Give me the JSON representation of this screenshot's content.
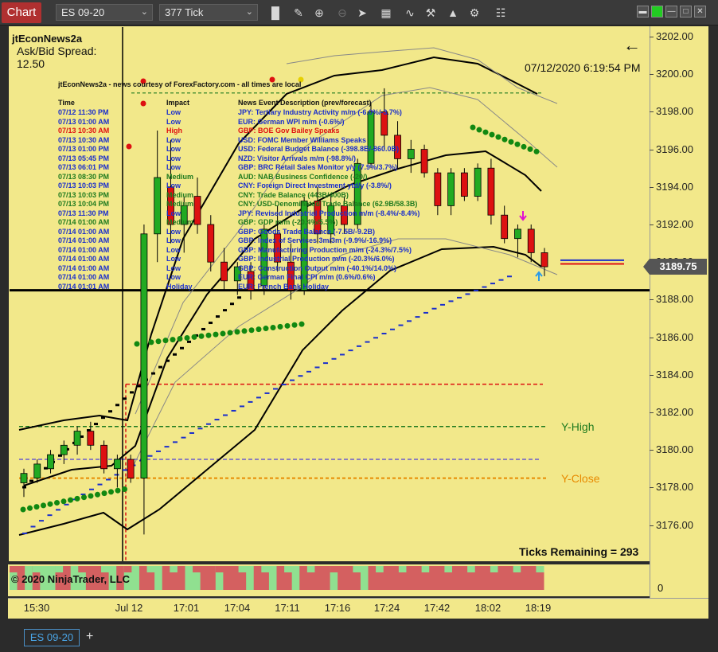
{
  "toolbar": {
    "chart_tab": "Chart",
    "instrument": "ES 09-20",
    "interval": "377 Tick",
    "icons": [
      "bar-type-icon",
      "drawing-tool-icon",
      "zoom-in-icon",
      "zoom-out-icon",
      "pointer-icon",
      "data-box-icon",
      "indicators-icon",
      "strategies-icon",
      "properties-icon"
    ],
    "window_buttons": [
      "minimize-icon",
      "link-icon",
      "restore-icon",
      "close-icon"
    ]
  },
  "chart": {
    "indicator_name": "jtEconNews2a",
    "spread_label": "Ask/Bid Spread:",
    "spread_value": "12.50",
    "timestamp": "07/12/2020 6:19:54 PM",
    "news_caption": "jtEconNews2a - news courtesy of ForexFactory.com - all times are local",
    "news_columns": [
      "Time",
      "Impact",
      "News Event Description (prev/forecast)"
    ],
    "news": [
      {
        "time": "07/12 11:30 PM",
        "impact": "Low",
        "desc": "JPY: Tertiary Industry Activity m/m (-6.0%/-3.7%)",
        "color": "#1a2ecc"
      },
      {
        "time": "07/13 01:00 AM",
        "impact": "Low",
        "desc": "EUR: German WPI m/m (-0.6%/)",
        "color": "#1a2ecc"
      },
      {
        "time": "07/13 10:30 AM",
        "impact": "High",
        "desc": "GBP: BOE Gov Bailey Speaks",
        "color": "#e01010"
      },
      {
        "time": "07/13 10:30 AM",
        "impact": "Low",
        "desc": "USD: FOMC Member Williams Speaks",
        "color": "#1a2ecc"
      },
      {
        "time": "07/13 01:00 PM",
        "impact": "Low",
        "desc": "USD: Federal Budget Balance (-398.8B/-860.0B)",
        "color": "#1a2ecc"
      },
      {
        "time": "07/13 05:45 PM",
        "impact": "Low",
        "desc": "NZD: Visitor Arrivals m/m (-98.8%/)",
        "color": "#1a2ecc"
      },
      {
        "time": "07/13 06:01 PM",
        "impact": "Low",
        "desc": "GBP: BRC Retail Sales Monitor y/y (7.9%/3.7%)",
        "color": "#1a2ecc"
      },
      {
        "time": "07/13 08:30 PM",
        "impact": "Medium",
        "desc": "AUD: NAB Business Confidence (-20/)",
        "color": "#1e7a1e"
      },
      {
        "time": "07/13 10:03 PM",
        "impact": "Low",
        "desc": "CNY: Foreign Direct Investment ytd/y (-3.8%/)",
        "color": "#1a2ecc"
      },
      {
        "time": "07/13 10:03 PM",
        "impact": "Medium",
        "desc": "CNY: Trade Balance (443B/400B)",
        "color": "#1e7a1e"
      },
      {
        "time": "07/13 10:04 PM",
        "impact": "Medium",
        "desc": "CNY: USD-Denominated Trade Balance (62.9B/58.3B)",
        "color": "#1e7a1e"
      },
      {
        "time": "07/13 11:30 PM",
        "impact": "Low",
        "desc": "JPY: Revised Industrial Production m/m (-8.4%/-8.4%)",
        "color": "#1a2ecc"
      },
      {
        "time": "07/14 01:00 AM",
        "impact": "Medium",
        "desc": "GBP: GDP m/m (-20.4%/5.5%)",
        "color": "#1e7a1e"
      },
      {
        "time": "07/14 01:00 AM",
        "impact": "Low",
        "desc": "GBP: Goods Trade Balance (-7.5B/-9.2B)",
        "color": "#1a2ecc"
      },
      {
        "time": "07/14 01:00 AM",
        "impact": "Low",
        "desc": "GBP: Index of Services 3m/3m (-9.9%/-16.9%)",
        "color": "#1a2ecc"
      },
      {
        "time": "07/14 01:00 AM",
        "impact": "Low",
        "desc": "GBP: Manufacturing Production m/m (-24.3%/7.5%)",
        "color": "#1a2ecc"
      },
      {
        "time": "07/14 01:00 AM",
        "impact": "Low",
        "desc": "GBP: Industrial Production m/m (-20.3%/6.0%)",
        "color": "#1a2ecc"
      },
      {
        "time": "07/14 01:00 AM",
        "impact": "Low",
        "desc": "GBP: Construction Output m/m (-40.1%/14.0%)",
        "color": "#1a2ecc"
      },
      {
        "time": "07/14 01:00 AM",
        "impact": "Low",
        "desc": "EUR: German Final CPI m/m (0.6%/0.6%)",
        "color": "#1a2ecc"
      },
      {
        "time": "07/14 01:01 AM",
        "impact": "Holiday",
        "desc": "EUR: French Bank Holiday",
        "color": "#1a2ecc"
      }
    ],
    "y_high_label": "Y-High",
    "y_close_label": "Y-Close",
    "ticks_remaining": "Ticks Remaining = 293",
    "copyright": "© 2020 NinjaTrader, LLC",
    "last_price": "3189.75",
    "y_ticks": [
      "3202.00",
      "3200.00",
      "3198.00",
      "3196.00",
      "3194.00",
      "3192.00",
      "3190.00",
      "3188.00",
      "3186.00",
      "3184.00",
      "3182.00",
      "3180.00",
      "3178.00",
      "3176.00"
    ],
    "panel_tick": "0",
    "x_ticks": [
      "15:30",
      "Jul 12",
      "17:01",
      "17:04",
      "17:11",
      "17:16",
      "17:24",
      "17:42",
      "18:02",
      "18:19"
    ],
    "colors": {
      "background": "#f2e88a",
      "up": "#22aa22",
      "down": "#dd1111",
      "dots": "#118811",
      "vwap": "#1a2ecc"
    }
  },
  "chart_data": {
    "type": "candlestick",
    "ylim": [
      3174.5,
      3203
    ],
    "y_high": 3181.25,
    "y_close": 3178.5,
    "y_open": 3179.5,
    "prior_level": 3183.5,
    "support_level": 3188.5,
    "last_price": 3189.75,
    "candles": [
      {
        "o": 3178.25,
        "h": 3179.0,
        "l": 3177.5,
        "c": 3178.75
      },
      {
        "o": 3178.5,
        "h": 3179.5,
        "l": 3178.25,
        "c": 3179.25
      },
      {
        "o": 3179.0,
        "h": 3180.0,
        "l": 3178.75,
        "c": 3179.75
      },
      {
        "o": 3179.75,
        "h": 3180.5,
        "l": 3179.25,
        "c": 3180.25
      },
      {
        "o": 3180.25,
        "h": 3181.25,
        "l": 3179.75,
        "c": 3181.0
      },
      {
        "o": 3181.0,
        "h": 3181.5,
        "l": 3180.0,
        "c": 3180.25
      },
      {
        "o": 3180.25,
        "h": 3180.5,
        "l": 3178.75,
        "c": 3179.0
      },
      {
        "o": 3179.0,
        "h": 3179.75,
        "l": 3178.0,
        "c": 3179.5
      },
      {
        "o": 3179.5,
        "h": 3179.75,
        "l": 3178.25,
        "c": 3178.5
      },
      {
        "o": 3178.5,
        "h": 3192.0,
        "l": 3175.5,
        "c": 3191.5
      },
      {
        "o": 3191.5,
        "h": 3197.0,
        "l": 3190.0,
        "c": 3194.5
      },
      {
        "o": 3194.0,
        "h": 3196.5,
        "l": 3191.0,
        "c": 3192.0
      },
      {
        "o": 3192.0,
        "h": 3193.5,
        "l": 3190.5,
        "c": 3193.0
      },
      {
        "o": 3193.5,
        "h": 3194.5,
        "l": 3191.5,
        "c": 3192.0
      },
      {
        "o": 3192.0,
        "h": 3192.5,
        "l": 3189.5,
        "c": 3190.0
      },
      {
        "o": 3190.0,
        "h": 3190.75,
        "l": 3188.5,
        "c": 3189.0
      },
      {
        "o": 3189.0,
        "h": 3190.0,
        "l": 3188.25,
        "c": 3189.75
      },
      {
        "o": 3189.5,
        "h": 3190.0,
        "l": 3188.0,
        "c": 3188.5
      },
      {
        "o": 3188.75,
        "h": 3192.0,
        "l": 3188.25,
        "c": 3191.75
      },
      {
        "o": 3191.5,
        "h": 3193.0,
        "l": 3189.5,
        "c": 3190.0
      },
      {
        "o": 3190.0,
        "h": 3191.0,
        "l": 3188.0,
        "c": 3188.5
      },
      {
        "o": 3188.5,
        "h": 3193.5,
        "l": 3188.25,
        "c": 3193.25
      },
      {
        "o": 3193.25,
        "h": 3194.0,
        "l": 3191.0,
        "c": 3191.5
      },
      {
        "o": 3191.5,
        "h": 3193.5,
        "l": 3191.0,
        "c": 3193.0
      },
      {
        "o": 3193.0,
        "h": 3193.5,
        "l": 3191.5,
        "c": 3192.0
      },
      {
        "o": 3192.0,
        "h": 3195.5,
        "l": 3191.75,
        "c": 3195.25
      },
      {
        "o": 3195.25,
        "h": 3198.5,
        "l": 3195.0,
        "c": 3198.0
      },
      {
        "o": 3198.0,
        "h": 3199.25,
        "l": 3196.0,
        "c": 3196.75
      },
      {
        "o": 3196.75,
        "h": 3197.5,
        "l": 3195.0,
        "c": 3195.5
      },
      {
        "o": 3195.5,
        "h": 3196.5,
        "l": 3194.75,
        "c": 3196.0
      },
      {
        "o": 3196.0,
        "h": 3196.25,
        "l": 3194.5,
        "c": 3194.75
      },
      {
        "o": 3194.75,
        "h": 3195.0,
        "l": 3192.5,
        "c": 3193.0
      },
      {
        "o": 3193.0,
        "h": 3195.0,
        "l": 3192.5,
        "c": 3194.75
      },
      {
        "o": 3194.75,
        "h": 3195.0,
        "l": 3193.25,
        "c": 3193.5
      },
      {
        "o": 3193.5,
        "h": 3195.25,
        "l": 3193.25,
        "c": 3195.0
      },
      {
        "o": 3195.0,
        "h": 3195.5,
        "l": 3192.0,
        "c": 3192.5
      },
      {
        "o": 3192.5,
        "h": 3193.0,
        "l": 3191.0,
        "c": 3191.25
      },
      {
        "o": 3191.25,
        "h": 3192.0,
        "l": 3190.25,
        "c": 3191.75
      },
      {
        "o": 3191.75,
        "h": 3192.0,
        "l": 3190.0,
        "c": 3190.5
      },
      {
        "o": 3190.5,
        "h": 3190.75,
        "l": 3189.25,
        "c": 3189.75
      }
    ],
    "indicator_panel": {
      "label": "0",
      "colors": [
        "g",
        "r",
        "g",
        "r",
        "g",
        "g",
        "r",
        "r",
        "g",
        "g",
        "r",
        "r",
        "r",
        "g",
        "r",
        "g",
        "g",
        "r",
        "r",
        "g",
        "r",
        "r",
        "r",
        "g",
        "g",
        "r",
        "r",
        "g",
        "r",
        "r",
        "r",
        "g",
        "r",
        "r",
        "g",
        "r",
        "r",
        "g",
        "r",
        "r",
        "r",
        "r",
        "g",
        "r",
        "r",
        "r",
        "g",
        "r",
        "r",
        "r",
        "r",
        "r",
        "r",
        "r",
        "r",
        "r",
        "r",
        "r",
        "r",
        "r",
        "r",
        "r",
        "r",
        "r",
        "r",
        "r",
        "r",
        "r",
        "r",
        "r"
      ]
    }
  }
}
